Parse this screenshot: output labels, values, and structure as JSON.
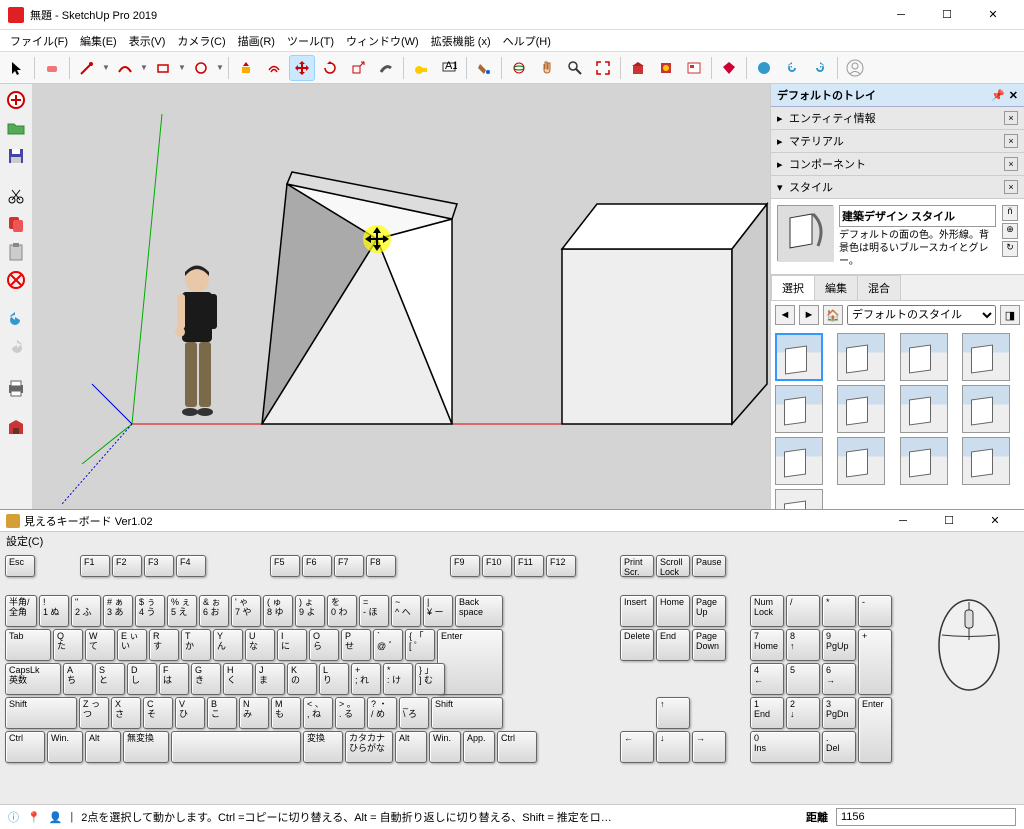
{
  "window": {
    "title": "無題 - SketchUp Pro 2019"
  },
  "menu": {
    "file": "ファイル(F)",
    "edit": "編集(E)",
    "view": "表示(V)",
    "camera": "カメラ(C)",
    "draw": "描画(R)",
    "tools": "ツール(T)",
    "window": "ウィンドウ(W)",
    "ext": "拡張機能 (x)",
    "help": "ヘルプ(H)"
  },
  "tray": {
    "title": "デフォルトのトレイ",
    "entity": "エンティティ情報",
    "material": "マテリアル",
    "component": "コンポーネント",
    "style": "スタイル"
  },
  "style": {
    "title": "建築デザイン スタイル",
    "desc": "デフォルトの面の色。外形線。背景色は明るいブルースカイとグレー。",
    "tab_select": "選択",
    "tab_edit": "編集",
    "tab_mix": "混合",
    "dropdown": "デフォルトのスタイル"
  },
  "kbd": {
    "title": "見えるキーボード Ver1.02",
    "settings": "設定(C)"
  },
  "keys": {
    "esc": "Esc",
    "f1": "F1",
    "f2": "F2",
    "f3": "F3",
    "f4": "F4",
    "f5": "F5",
    "f6": "F6",
    "f7": "F7",
    "f8": "F8",
    "f9": "F9",
    "f10": "F10",
    "f11": "F11",
    "f12": "F12",
    "prtsc": "Print\nScr.",
    "scrlk": "Scroll\nLock",
    "pause": "Pause",
    "hankaku": "半角/\n全角",
    "backspace": "Back\nspace",
    "tab": "Tab",
    "enter": "Enter",
    "capslock": "CapsLk\n英数",
    "shift": "Shift",
    "ctrl": "Ctrl",
    "win": "Win.",
    "alt": "Alt",
    "muhenkan": "無変換",
    "henkan": "変換",
    "katakana": "カタカナ\nひらがな",
    "app": "App.",
    "insert": "Insert",
    "home": "Home",
    "pgup": "Page\nUp",
    "delete": "Delete",
    "end": "End",
    "pgdn": "Page\nDown",
    "numlock": "Num\nLock",
    "numdiv": "/",
    "nummul": "*",
    "numsub": "-",
    "numadd": "+",
    "numenter": "Enter",
    "num7": "7\nHome",
    "num8": "8\n↑",
    "num9": "9\nPgUp",
    "num4": "4\n←",
    "num5": "5",
    "num6": "6\n→",
    "num1": "1\nEnd",
    "num2": "2\n↓",
    "num3": "3\nPgDn",
    "num0": "0\nIns",
    "numdot": ".\nDel",
    "r1": [
      "!\n1 ぬ",
      "\"\n2 ふ",
      "# ぁ\n3 あ",
      "$ ぅ\n4 う",
      "% ぇ\n5 え",
      "& ぉ\n6 お",
      "' ゃ\n7 や",
      "( ゅ\n8 ゆ",
      ") ょ\n9 よ",
      "  を\n0 わ",
      "= \n- ほ",
      "~\n^ へ",
      "|\n¥ ー"
    ],
    "r2": [
      "Q\n  た",
      "W\n  て",
      "E ぃ\n  い",
      "R\n  す",
      "T\n  か",
      "Y\n  ん",
      "U\n  な",
      "I\n  に",
      "O\n  ら",
      "P\n  せ",
      "`\n@ ゛",
      "{ 「\n[ ゜"
    ],
    "r3": [
      "A\n  ち",
      "S\n  と",
      "D\n  し",
      "F\n  は",
      "G\n  き",
      "H\n  く",
      "J\n  ま",
      "K\n  の",
      "L\n  り",
      "+\n; れ",
      "*\n: け",
      "} 」\n] む"
    ],
    "r4": [
      "Z っ\n  つ",
      "X\n  さ",
      "C\n  そ",
      "V\n  ひ",
      "B\n  こ",
      "N\n  み",
      "M\n  も",
      "< 、\n, ね",
      "> 。\n. る",
      "? ・\n/ め",
      "_\n\\ ろ"
    ]
  },
  "status": {
    "hint": "2点を選択して動かします。Ctrl =コピーに切り替える、Alt = 自動折り返しに切り替える、Shift = 推定をロ…",
    "label": "距離",
    "value": "1156"
  }
}
